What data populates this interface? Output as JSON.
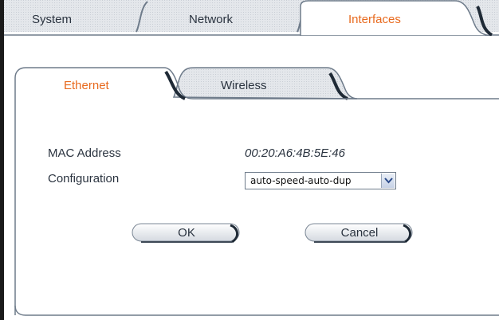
{
  "top_tabs": [
    {
      "label": "System",
      "active": false
    },
    {
      "label": "Network",
      "active": false
    },
    {
      "label": "Interfaces",
      "active": true
    }
  ],
  "sub_tabs": [
    {
      "label": "Ethernet",
      "active": true
    },
    {
      "label": "Wireless",
      "active": false
    }
  ],
  "form": {
    "mac_label": "MAC Address",
    "mac_value": "00:20:A6:4B:5E:46",
    "config_label": "Configuration",
    "config_value": "auto-speed-auto-dup"
  },
  "buttons": {
    "ok_label": "OK",
    "cancel_label": "Cancel"
  },
  "colors": {
    "active_tab_text": "#e86a1e",
    "text": "#2b3440",
    "tab_fill": "#d7dbe0"
  }
}
